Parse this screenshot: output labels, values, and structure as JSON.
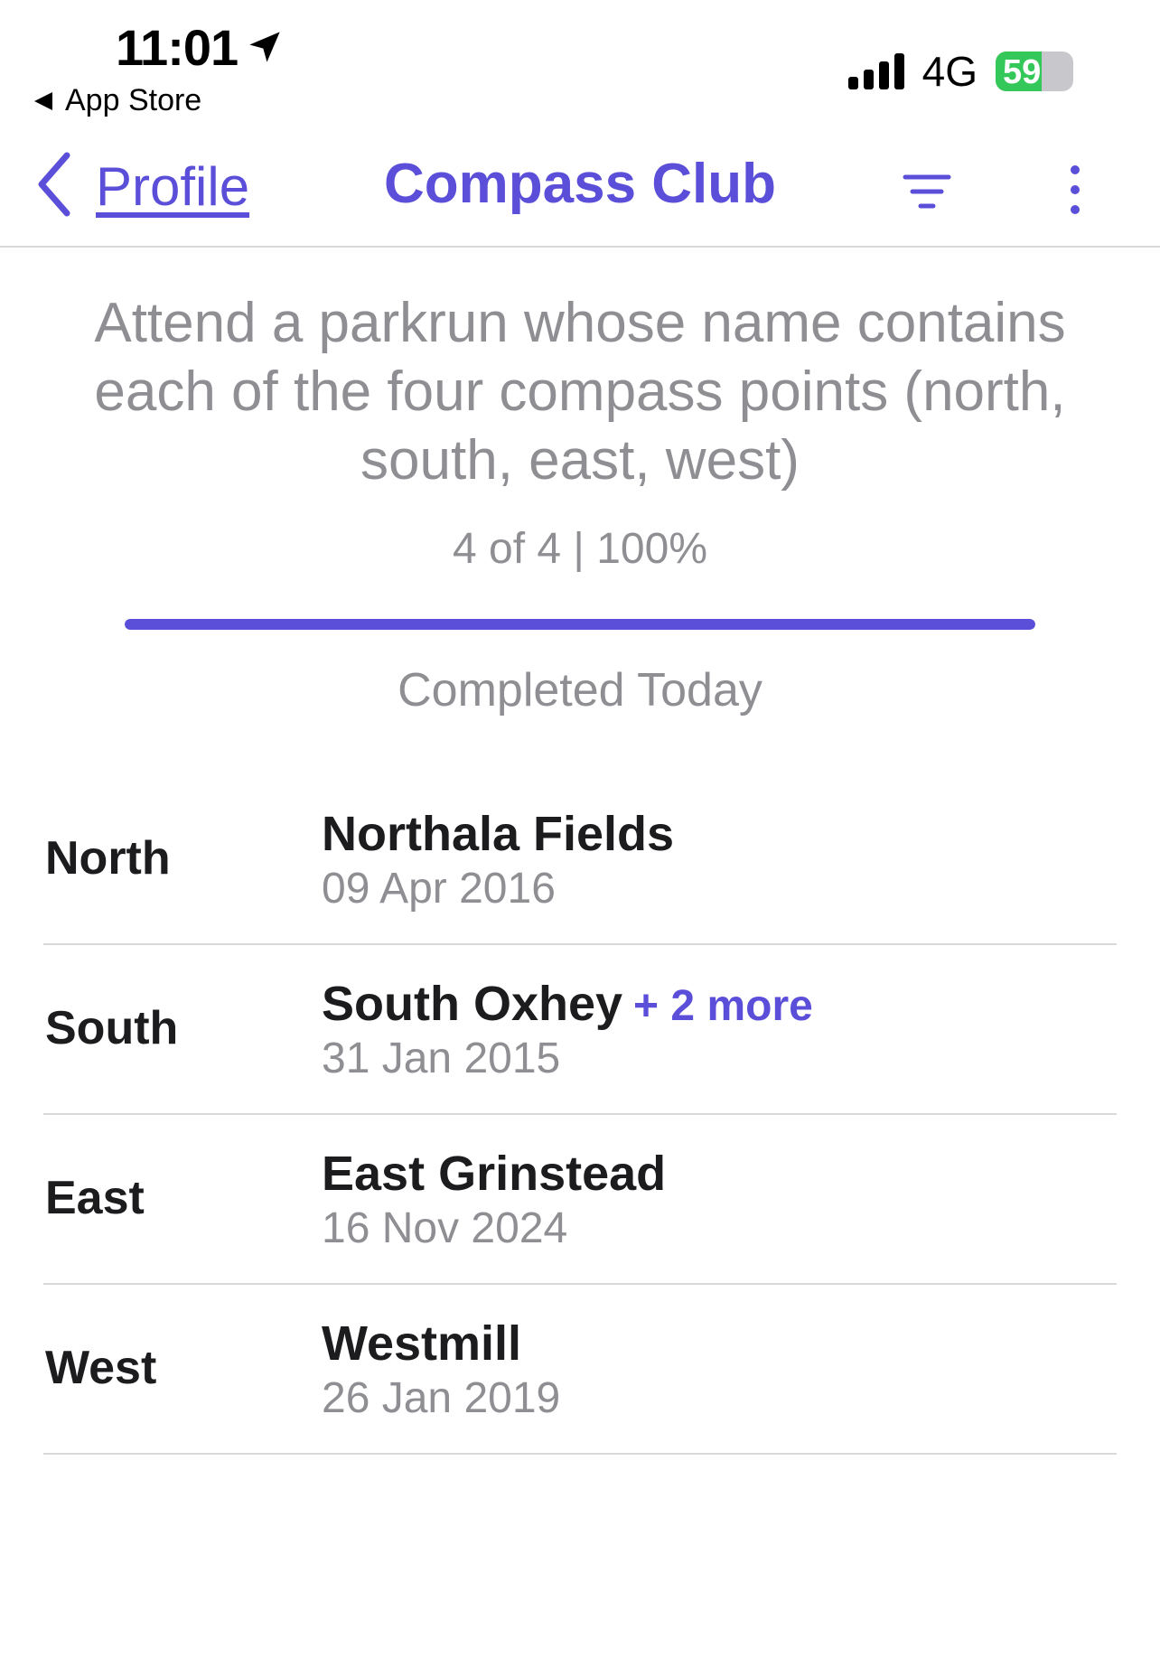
{
  "status_bar": {
    "time": "11:01",
    "back_app": "App Store",
    "network": "4G",
    "battery_level": "59",
    "battery_fraction": 0.59
  },
  "nav": {
    "back_label": "Profile",
    "title": "Compass Club",
    "accent_color": "#5b4fd9"
  },
  "challenge": {
    "description": "Attend a parkrun whose name contains each of the four compass points (north, south, east, west)",
    "progress_text": "4 of 4 | 100%",
    "progress_fraction": 1.0,
    "completed_text": "Completed Today"
  },
  "rows": [
    {
      "direction": "North",
      "name": "Northala Fields",
      "more": "",
      "date": "09 Apr 2016"
    },
    {
      "direction": "South",
      "name": "South Oxhey",
      "more": "+ 2 more",
      "date": "31 Jan 2015"
    },
    {
      "direction": "East",
      "name": "East Grinstead",
      "more": "",
      "date": "16 Nov 2024"
    },
    {
      "direction": "West",
      "name": "Westmill",
      "more": "",
      "date": "26 Jan 2019"
    }
  ]
}
